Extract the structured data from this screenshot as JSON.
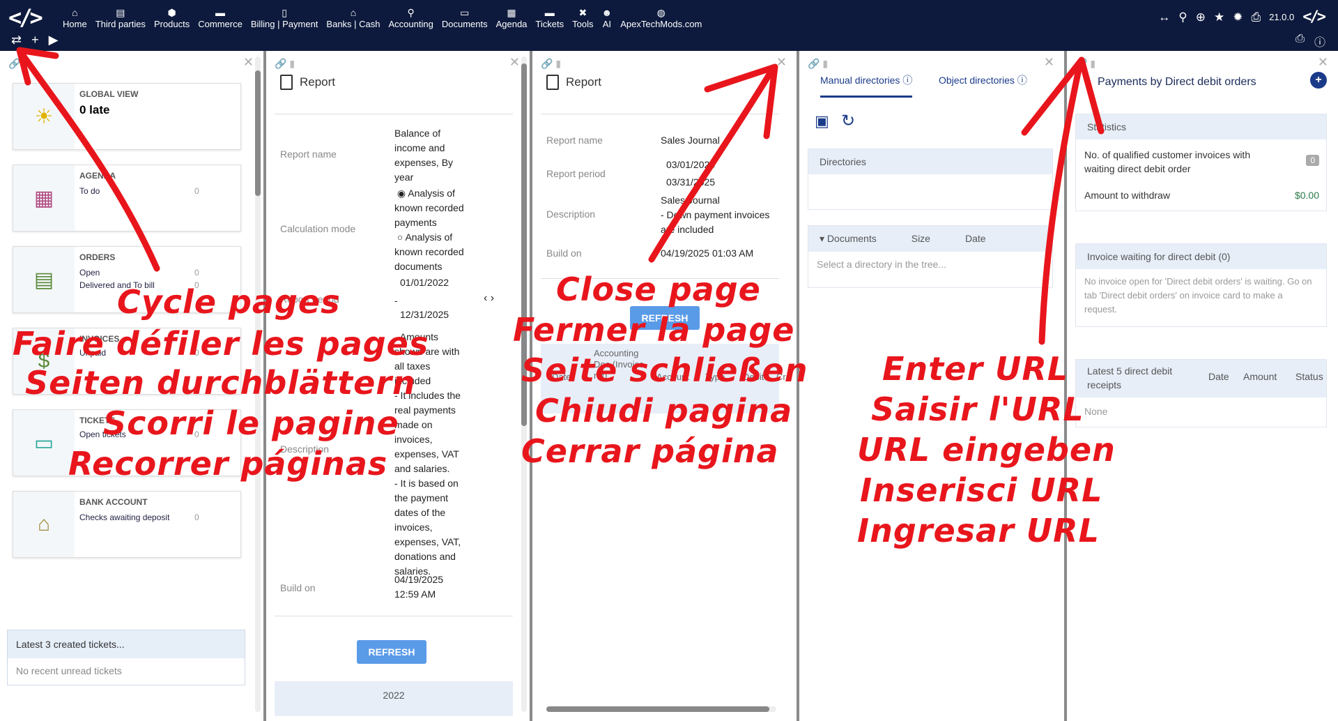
{
  "nav": {
    "logo": "</>",
    "items": [
      {
        "label": "Home",
        "icon": "⌂"
      },
      {
        "label": "Third parties",
        "icon": "▤"
      },
      {
        "label": "Products",
        "icon": "⬢"
      },
      {
        "label": "Commerce",
        "icon": "▬"
      },
      {
        "label": "Billing | Payment",
        "icon": "▯"
      },
      {
        "label": "Banks | Cash",
        "icon": "⌂"
      },
      {
        "label": "Accounting",
        "icon": "⚲"
      },
      {
        "label": "Documents",
        "icon": "▭"
      },
      {
        "label": "Agenda",
        "icon": "▦"
      },
      {
        "label": "Tickets",
        "icon": "▬"
      },
      {
        "label": "Tools",
        "icon": "✖"
      },
      {
        "label": "AI",
        "icon": "☻"
      },
      {
        "label": "ApexTechMods.com",
        "icon": "◍"
      }
    ],
    "left_tools": [
      "⇄",
      "+",
      "▶"
    ],
    "right_tools": [
      "↔",
      "⚲",
      "⊕",
      "★",
      "✹",
      "⎙"
    ],
    "version": "21.0.0",
    "right_tools2": [
      "⎙",
      "ⓘ"
    ]
  },
  "panel1": {
    "global_view": {
      "title": "GLOBAL VIEW",
      "value": "0 late"
    },
    "agenda": {
      "title": "AGENDA",
      "line": "To do",
      "count": "0"
    },
    "orders": {
      "title": "ORDERS",
      "line1": "Open",
      "count1": "0",
      "line2": "Delivered and To bill",
      "count2": "0"
    },
    "invoices": {
      "title": "INVOICES",
      "line": "Unpaid",
      "count": "0"
    },
    "tickets": {
      "title": "TICKETS",
      "line": "Open tickets",
      "count": "0"
    },
    "bank": {
      "title": "BANK ACCOUNT",
      "line": "Checks awaiting deposit",
      "count": "0"
    },
    "latest_tickets": {
      "header": "Latest 3 created tickets...",
      "body": "No recent unread tickets"
    }
  },
  "panel2": {
    "title": "Report",
    "report_name_label": "Report name",
    "report_name": [
      "Balance of",
      "income and",
      "expenses, By",
      "year"
    ],
    "calc_label": "Calculation mode",
    "opt1": [
      "Analysis of",
      "known recorded",
      "payments"
    ],
    "opt2": [
      "Analysis of",
      "known recorded",
      "documents"
    ],
    "period_label": "Report period",
    "date1": "01/01/2022",
    "date2": "12/31/2025",
    "description_label": "Description",
    "description": [
      "- Amounts",
      "shown are with",
      "all taxes",
      "included",
      "- It includes the",
      "real payments",
      "made on",
      "invoices,",
      "expenses, VAT",
      "and salaries.",
      "- It is based on",
      "the payment",
      "dates of the",
      "invoices,",
      "expenses, VAT,",
      "donations and",
      "salaries."
    ],
    "build_label": "Build on",
    "build": [
      "04/19/2025",
      "12:59 AM"
    ],
    "refresh": "REFRESH",
    "year_header": "2022"
  },
  "panel3": {
    "title": "Report",
    "report_name_label": "Report name",
    "report_name": "Sales Journal",
    "period_label": "Report period",
    "date1": "03/01/2025",
    "date2": "03/31/2025",
    "description_label": "Description",
    "description": [
      "Sales Journal",
      "- Down payment invoices",
      "are included"
    ],
    "build_label": "Build on",
    "build": "04/19/2025 01:03 AM",
    "refresh": "REFRESH",
    "table_headers": [
      "Date",
      "Accounting Doc (Invoice ref)",
      "Account",
      "Type",
      "Debit",
      "Cre"
    ]
  },
  "panel4": {
    "tab1": "Manual directories",
    "tab2": "Object directories",
    "directories": "Directories",
    "documents": "Documents",
    "size": "Size",
    "date": "Date",
    "select_hint": "Select a directory in the tree..."
  },
  "panel5": {
    "title": "Payments by Direct debit orders",
    "stats_header": "Statistics",
    "stat1_label": "No. of qualified customer invoices with waiting direct debit order",
    "stat1_value": "0",
    "stat2_label": "Amount to withdraw",
    "stat2_value": "$0.00",
    "waiting_header": "Invoice waiting for direct debit (0)",
    "waiting_body": "No invoice open for 'Direct debit orders' is waiting. Go on tab 'Direct debit orders' on invoice card to make a request.",
    "receipts_header": "Latest 5 direct debit receipts",
    "receipts_cols": [
      "Date",
      "Amount",
      "Status"
    ],
    "receipts_none": "None"
  },
  "annotations": {
    "cycle": [
      "Cycle pages",
      "Faire défiler les pages",
      "Seiten durchblättern",
      "Scorri le pagine",
      "Recorrer páginas"
    ],
    "close": [
      "Close page",
      "Fermer la page",
      "Seite schließen",
      "Chiudi pagina",
      "Cerrar página"
    ],
    "url": [
      "Enter URL",
      "Saisir l'URL",
      "URL eingeben",
      "Inserisci URL",
      "Ingresar URL"
    ],
    "color": "#e8161c"
  }
}
